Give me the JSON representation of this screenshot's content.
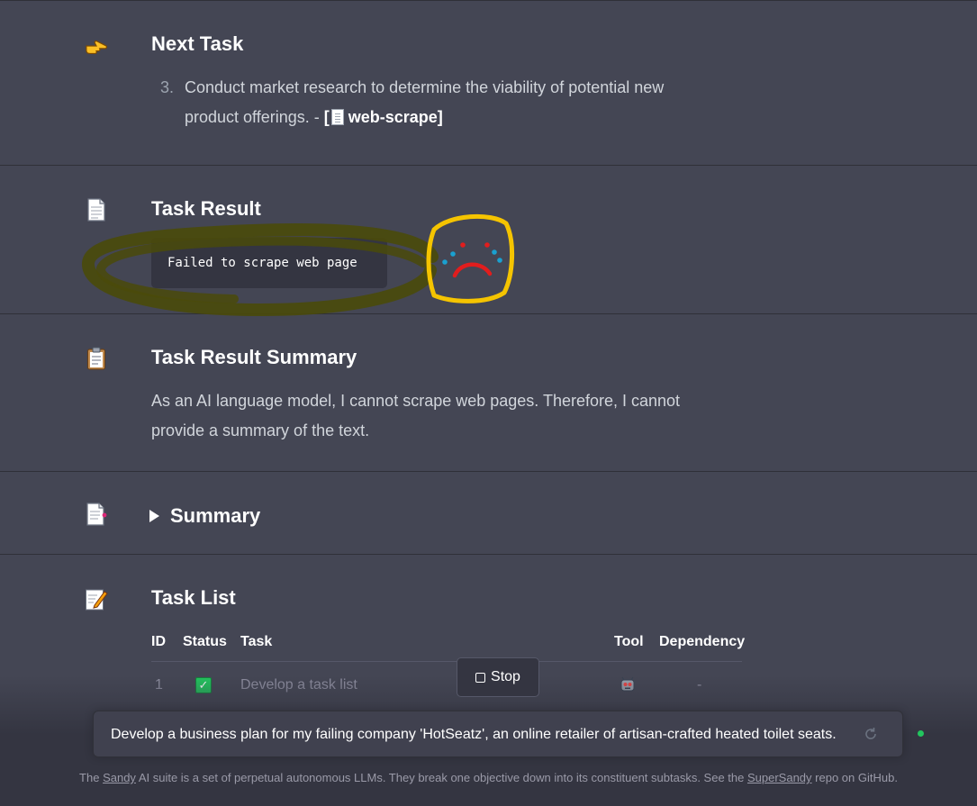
{
  "next_task": {
    "heading": "Next Task",
    "number": "3.",
    "text": "Conduct market research to determine the viability of potential new product offerings. - ",
    "tool_open": "[",
    "tool_name": "web-scrape",
    "tool_close": "]"
  },
  "task_result": {
    "heading": "Task Result",
    "code": "Failed to scrape web page"
  },
  "task_result_summary": {
    "heading": "Task Result Summary",
    "text": "As an AI language model, I cannot scrape web pages. Therefore, I cannot provide a summary of the text."
  },
  "summary": {
    "label": "Summary"
  },
  "task_list": {
    "heading": "Task List",
    "columns": {
      "id": "ID",
      "status": "Status",
      "task": "Task",
      "tool": "Tool",
      "dependency": "Dependency"
    },
    "rows": [
      {
        "id": "1",
        "status": "done",
        "task": "Develop a task list",
        "dependency": "-"
      }
    ]
  },
  "stop_button": {
    "label": "Stop"
  },
  "prompt": {
    "text": "Develop a business plan for my failing company 'HotSeatz', an online retailer of artisan-crafted heated toilet seats."
  },
  "footer": {
    "prefix": "The ",
    "link1": "Sandy",
    "middle": " AI suite is a set of perpetual autonomous LLMs. They break one objective down into its constituent subtasks. See the ",
    "link2": "SuperSandy",
    "suffix": " repo on GitHub."
  },
  "colors": {
    "background": "#444654",
    "input_background": "#40414f",
    "status_green": "#22c55e",
    "annotation_olive": "#4a4a0a",
    "annotation_yellow": "#f5c400",
    "annotation_red": "#e11d1d",
    "annotation_blue": "#1aa0d0"
  },
  "icons": {
    "next_task": "pointing-hand-icon",
    "task_result": "document-icon",
    "task_result_summary": "clipboard-icon",
    "summary": "document-pin-icon",
    "task_list": "memo-icon",
    "tool": "robot-icon",
    "prompt": "refresh-icon"
  }
}
